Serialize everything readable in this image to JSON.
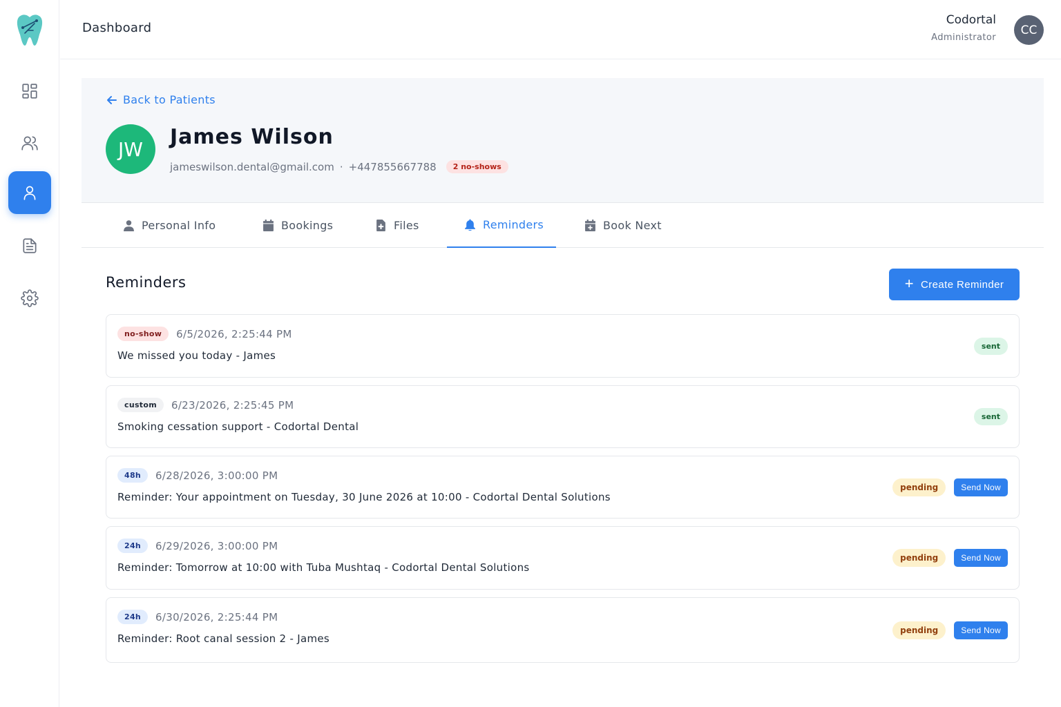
{
  "header": {
    "title": "Dashboard",
    "user_name": "Codortal",
    "user_role": "Administrator",
    "user_initials": "CC"
  },
  "sidebar": {
    "items": [
      {
        "name": "dashboard",
        "icon": "grid-icon",
        "active": false
      },
      {
        "name": "patients",
        "icon": "users-icon",
        "active": false
      },
      {
        "name": "patient",
        "icon": "user-icon",
        "active": true
      },
      {
        "name": "documents",
        "icon": "file-text-icon",
        "active": false
      },
      {
        "name": "settings",
        "icon": "gear-icon",
        "active": false
      }
    ]
  },
  "patient": {
    "back_label": "Back to Patients",
    "initials": "JW",
    "name": "James Wilson",
    "email": "jameswilson.dental@gmail.com",
    "separator": "·",
    "phone": "+447855667788",
    "noshow_badge": "2 no-shows"
  },
  "tabs": [
    {
      "label": "Personal Info",
      "icon": "person-icon"
    },
    {
      "label": "Bookings",
      "icon": "calendar-icon"
    },
    {
      "label": "Files",
      "icon": "file-plus-icon"
    },
    {
      "label": "Reminders",
      "icon": "bell-icon",
      "active": true
    },
    {
      "label": "Book Next",
      "icon": "calendar-plus-icon"
    }
  ],
  "reminders": {
    "title": "Reminders",
    "create_label": "Create Reminder",
    "send_label": "Send Now",
    "items": [
      {
        "type": "no-show",
        "date": "6/5/2026, 2:25:44 PM",
        "message": "We missed you today - James",
        "status": "sent"
      },
      {
        "type": "custom",
        "date": "6/23/2026, 2:25:45 PM",
        "message": "Smoking cessation support - Codortal Dental",
        "status": "sent"
      },
      {
        "type": "48h",
        "date": "6/28/2026, 3:00:00 PM",
        "message": "Reminder: Your appointment on Tuesday, 30 June 2026 at 10:00 - Codortal Dental Solutions",
        "status": "pending"
      },
      {
        "type": "24h",
        "date": "6/29/2026, 3:00:00 PM",
        "message": "Reminder: Tomorrow at 10:00 with Tuba Mushtaq - Codortal Dental Solutions",
        "status": "pending"
      },
      {
        "type": "24h",
        "date": "6/30/2026, 2:25:44 PM",
        "message": "Reminder: Root canal session 2 - James",
        "status": "pending"
      }
    ]
  },
  "colors": {
    "accent": "#2f80ed",
    "avatar_green": "#1db87a",
    "sent_bg": "#dcf5e7",
    "pending_bg": "#fdf1cc"
  }
}
